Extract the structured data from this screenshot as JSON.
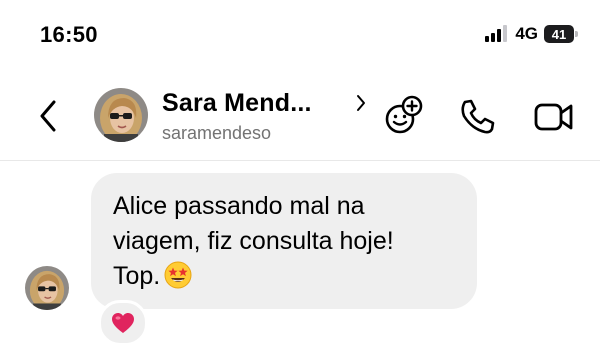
{
  "status_bar": {
    "time": "16:50",
    "network": "4G",
    "battery": "41"
  },
  "header": {
    "name": "Sara Mend...",
    "username": "saramendeso"
  },
  "message": {
    "lines": [
      "Alice passando mal na",
      "viagem, fiz consulta hoje!",
      "Top."
    ],
    "emoji": "star-struck-emoji",
    "reaction": "heart"
  },
  "colors": {
    "bubble": "#efefef",
    "secondary_text": "#737373",
    "reaction_heart": "#e0245e"
  }
}
